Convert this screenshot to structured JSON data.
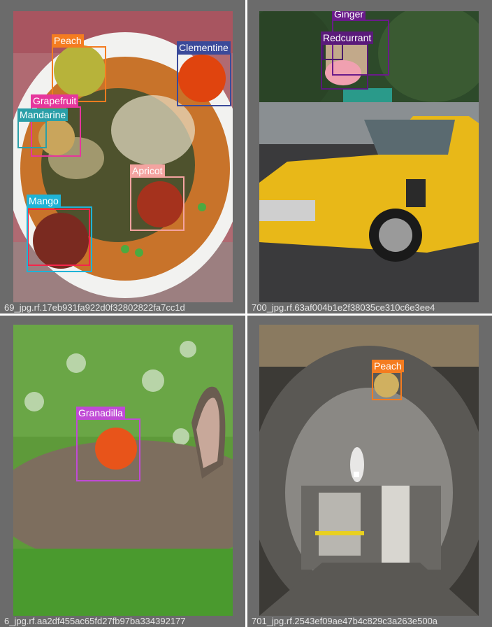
{
  "panels": [
    {
      "caption": "69_jpg.rf.17eb931fa922d0f32802822fa7cc1d",
      "boxes": [
        {
          "label": "Peach",
          "color": "#f47c20"
        },
        {
          "label": "Clementine",
          "color": "#3a4a9a"
        },
        {
          "label": "Grapefruit",
          "color": "#e6369c"
        },
        {
          "label": "Mandarine",
          "color": "#2a9fa8"
        },
        {
          "label": "Apricot",
          "color": "#f4a3a0"
        },
        {
          "label": "Mango",
          "color": "#1fb3d6"
        },
        {
          "label": "",
          "color": "#f5254a"
        }
      ]
    },
    {
      "caption": "700_jpg.rf.63af004b1e2f38035ce310c6e3ee4",
      "boxes": [
        {
          "label": "Ginger",
          "color": "#6a1b8a"
        },
        {
          "label": "Redcurrant",
          "color": "#5a1a7a"
        },
        {
          "label": "",
          "color": "#4a1a6a"
        }
      ]
    },
    {
      "caption": "6_jpg.rf.aa2df455ac65fd27fb97ba334392177",
      "boxes": [
        {
          "label": "Granadilla",
          "color": "#c04ad6"
        }
      ]
    },
    {
      "caption": "701_jpg.rf.2543ef09ae47b4c829c3a263e500a",
      "boxes": [
        {
          "label": "Peach",
          "color": "#f47c20"
        }
      ]
    }
  ]
}
